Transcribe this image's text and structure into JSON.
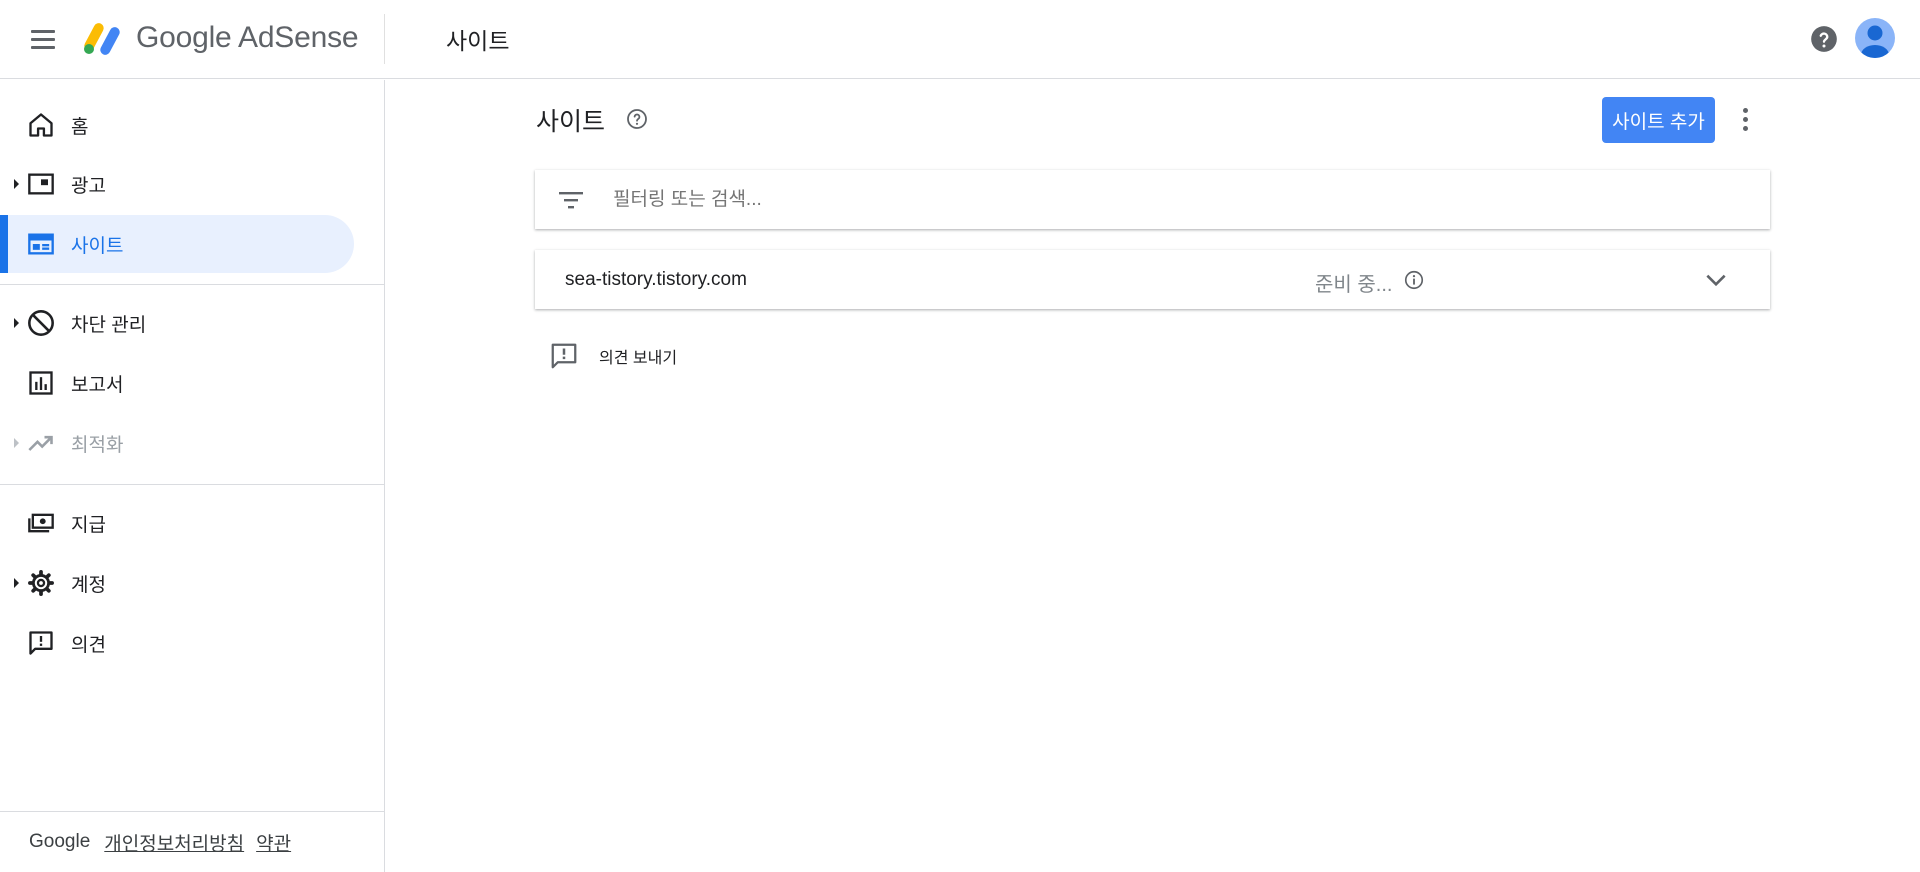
{
  "header": {
    "logo_text": "Google AdSense",
    "page_title": "사이트"
  },
  "sidebar": {
    "items": [
      {
        "label": "홈",
        "icon": "home-icon"
      },
      {
        "label": "광고",
        "icon": "ads-icon"
      },
      {
        "label": "사이트",
        "icon": "sites-icon",
        "active": true
      },
      {
        "label": "차단 관리",
        "icon": "block-icon"
      },
      {
        "label": "보고서",
        "icon": "reports-icon"
      },
      {
        "label": "최적화",
        "icon": "trending-up-icon",
        "disabled": true
      },
      {
        "label": "지급",
        "icon": "payments-icon"
      },
      {
        "label": "계정",
        "icon": "gear-icon"
      },
      {
        "label": "의견",
        "icon": "feedback-icon"
      }
    ]
  },
  "footer": {
    "brand": "Google",
    "privacy_link": "개인정보처리방침",
    "terms_link": "약관"
  },
  "main": {
    "title": "사이트",
    "add_site_label": "사이트 추가",
    "filter_placeholder": "필터링 또는 검색...",
    "sites": [
      {
        "name": "sea-tistory.tistory.com",
        "status": "준비 중..."
      }
    ],
    "feedback_label": "의견 보내기"
  },
  "colors": {
    "accent": "#1a73e8",
    "button": "#4285f4",
    "active_bg": "#e8f0fe"
  }
}
